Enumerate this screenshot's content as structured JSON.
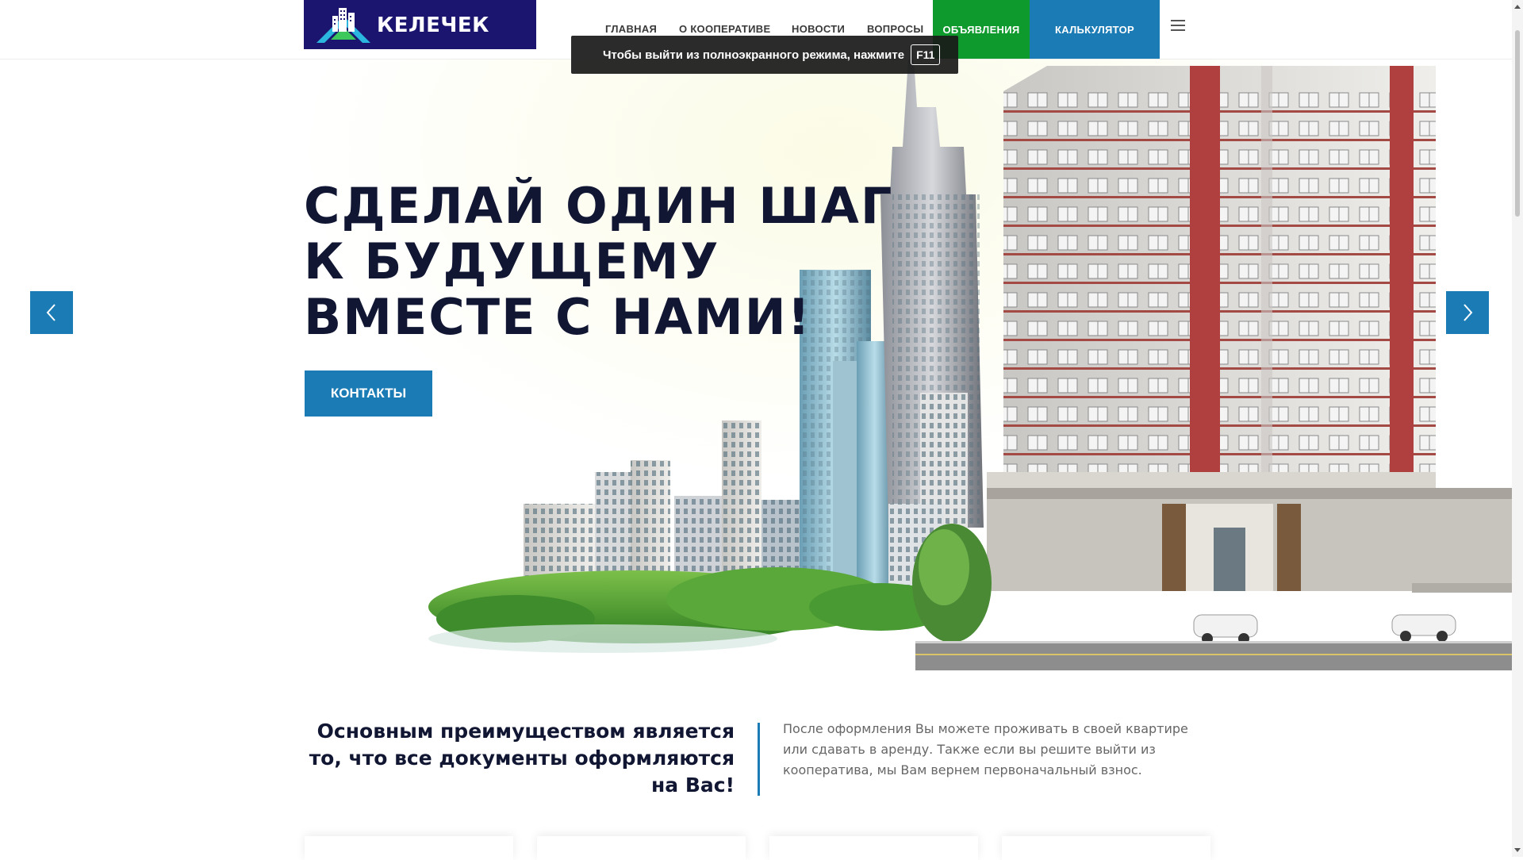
{
  "header": {
    "logo_text": "КЕЛЕЧЕК",
    "nav": [
      {
        "label": "ГЛАВНАЯ"
      },
      {
        "label": "О КООПЕРАТИВЕ"
      },
      {
        "label": "НОВОСТИ"
      },
      {
        "label": "ВОПРОСЫ"
      },
      {
        "label": "ОБЪЯВЛЕНИЯ"
      },
      {
        "label": "КАЛЬКУЛЯТОР"
      }
    ],
    "menu_icon": "hamburger-icon"
  },
  "fullscreen_notice": {
    "text": "Чтобы выйти из полноэкранного режима, нажмите",
    "key": "F11"
  },
  "hero": {
    "title_lines": [
      "СДЕЛАЙ ОДИН ШАГ",
      "К БУДУЩЕМУ",
      "ВМЕСТЕ С НАМИ!"
    ],
    "button_label": "КОНТАКТЫ",
    "prev_icon": "chevron-left-icon",
    "next_icon": "chevron-right-icon"
  },
  "about": {
    "headline": "Основным преимуществом является то, что все документы оформляются на Вас!",
    "description": "После оформления Вы можете проживать в своей квартире или сдавать в аренду. Также если вы решите выйти из кооператива, мы Вам вернем первоначальный взнос."
  },
  "colors": {
    "logo_bg": "#1b1570",
    "accent_blue": "#1b7bb5",
    "accent_green": "#0f9a2e",
    "title_dark": "#111633",
    "building_red": "#b04040"
  }
}
